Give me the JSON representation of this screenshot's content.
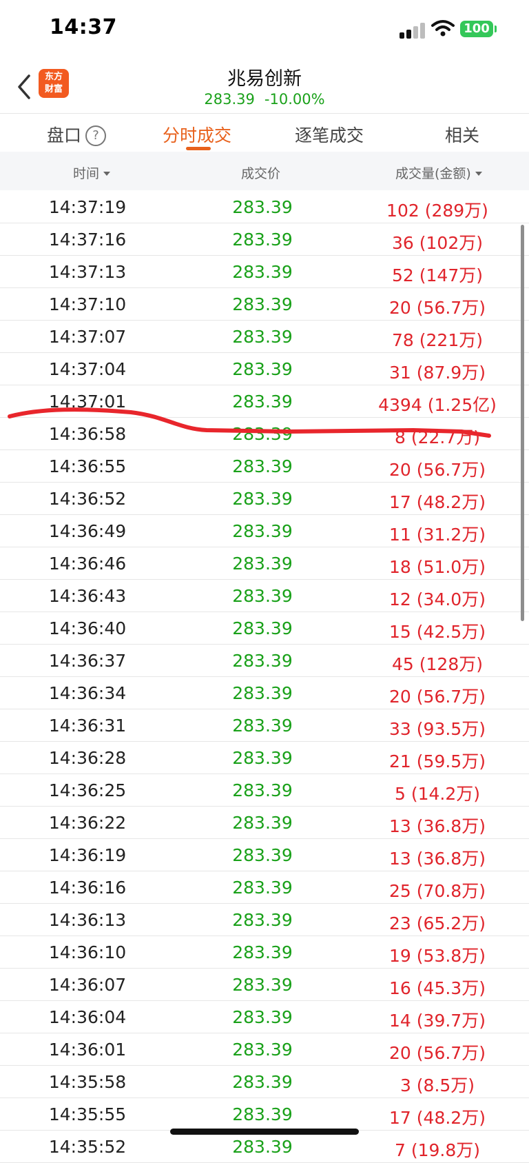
{
  "status_bar": {
    "time": "14:37",
    "battery": "100"
  },
  "nav": {
    "logo_line1": "东方",
    "logo_line2": "财富",
    "stock_name": "兆易创新",
    "price": "283.39",
    "change_pct": "-10.00%"
  },
  "tabs": [
    {
      "label": "盘口"
    },
    {
      "label": "分时成交"
    },
    {
      "label": "逐笔成交"
    },
    {
      "label": "相关"
    }
  ],
  "help_glyph": "?",
  "table": {
    "headers": {
      "time": "时间",
      "price": "成交价",
      "volume": "成交量(金额)"
    },
    "rows": [
      {
        "time": "14:37:19",
        "price": "283.39",
        "volume": "102 (289万)"
      },
      {
        "time": "14:37:16",
        "price": "283.39",
        "volume": "36 (102万)"
      },
      {
        "time": "14:37:13",
        "price": "283.39",
        "volume": "52 (147万)"
      },
      {
        "time": "14:37:10",
        "price": "283.39",
        "volume": "20 (56.7万)"
      },
      {
        "time": "14:37:07",
        "price": "283.39",
        "volume": "78 (221万)"
      },
      {
        "time": "14:37:04",
        "price": "283.39",
        "volume": "31 (87.9万)"
      },
      {
        "time": "14:37:01",
        "price": "283.39",
        "volume": "4394 (1.25亿)"
      },
      {
        "time": "14:36:58",
        "price": "283.39",
        "volume": "8 (22.7万)"
      },
      {
        "time": "14:36:55",
        "price": "283.39",
        "volume": "20 (56.7万)"
      },
      {
        "time": "14:36:52",
        "price": "283.39",
        "volume": "17 (48.2万)"
      },
      {
        "time": "14:36:49",
        "price": "283.39",
        "volume": "11 (31.2万)"
      },
      {
        "time": "14:36:46",
        "price": "283.39",
        "volume": "18 (51.0万)"
      },
      {
        "time": "14:36:43",
        "price": "283.39",
        "volume": "12 (34.0万)"
      },
      {
        "time": "14:36:40",
        "price": "283.39",
        "volume": "15 (42.5万)"
      },
      {
        "time": "14:36:37",
        "price": "283.39",
        "volume": "45 (128万)"
      },
      {
        "time": "14:36:34",
        "price": "283.39",
        "volume": "20 (56.7万)"
      },
      {
        "time": "14:36:31",
        "price": "283.39",
        "volume": "33 (93.5万)"
      },
      {
        "time": "14:36:28",
        "price": "283.39",
        "volume": "21 (59.5万)"
      },
      {
        "time": "14:36:25",
        "price": "283.39",
        "volume": "5 (14.2万)"
      },
      {
        "time": "14:36:22",
        "price": "283.39",
        "volume": "13 (36.8万)"
      },
      {
        "time": "14:36:19",
        "price": "283.39",
        "volume": "13 (36.8万)"
      },
      {
        "time": "14:36:16",
        "price": "283.39",
        "volume": "25 (70.8万)"
      },
      {
        "time": "14:36:13",
        "price": "283.39",
        "volume": "23 (65.2万)"
      },
      {
        "time": "14:36:10",
        "price": "283.39",
        "volume": "19 (53.8万)"
      },
      {
        "time": "14:36:07",
        "price": "283.39",
        "volume": "16 (45.3万)"
      },
      {
        "time": "14:36:04",
        "price": "283.39",
        "volume": "14 (39.7万)"
      },
      {
        "time": "14:36:01",
        "price": "283.39",
        "volume": "20 (56.7万)"
      },
      {
        "time": "14:35:58",
        "price": "283.39",
        "volume": "3 (8.5万)"
      },
      {
        "time": "14:35:55",
        "price": "283.39",
        "volume": "17 (48.2万)"
      },
      {
        "time": "14:35:52",
        "price": "283.39",
        "volume": "7 (19.8万)"
      }
    ]
  },
  "colors": {
    "accent": "#e8611c",
    "down_green": "#1aa11a",
    "volume_red": "#e0242b",
    "annotation_red": "#e8262c"
  },
  "icons": [
    "back-chevron-icon",
    "help-icon",
    "signal-icon",
    "wifi-icon",
    "battery-icon",
    "sort-caret-icon"
  ]
}
